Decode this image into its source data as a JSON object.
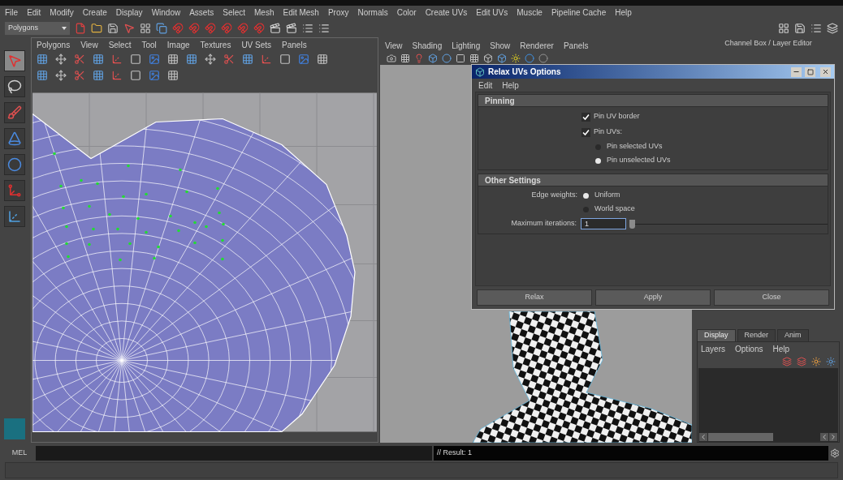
{
  "menu_bar": [
    "File",
    "Edit",
    "Modify",
    "Create",
    "Display",
    "Window",
    "Assets",
    "Select",
    "Mesh",
    "Edit Mesh",
    "Proxy",
    "Normals",
    "Color",
    "Create UVs",
    "Edit UVs",
    "Muscle",
    "Pipeline Cache",
    "Help"
  ],
  "toolbar": {
    "mode_dropdown": "Polygons"
  },
  "toolbox": [
    {
      "kind": "select",
      "selected": true
    },
    {
      "kind": "lasso",
      "selected": false
    },
    {
      "kind": "paint",
      "selected": false
    },
    {
      "kind": "cone",
      "selected": false
    },
    {
      "kind": "sphere",
      "selected": false
    },
    {
      "kind": "scale",
      "selected": false
    },
    {
      "kind": "axis",
      "selected": false
    }
  ],
  "uv_editor": {
    "menu": [
      "Polygons",
      "View",
      "Select",
      "Tool",
      "Image",
      "Textures",
      "UV Sets",
      "Panels"
    ]
  },
  "viewport": {
    "menu": [
      "View",
      "Shading",
      "Lighting",
      "Show",
      "Renderer",
      "Panels"
    ]
  },
  "channel_box": {
    "title": "Channel Box / Layer Editor",
    "tabs": [
      {
        "label": "Display",
        "selected": true
      },
      {
        "label": "Render",
        "selected": false
      },
      {
        "label": "Anim",
        "selected": false
      }
    ],
    "menu": [
      "Layers",
      "Options",
      "Help"
    ]
  },
  "command_line": {
    "language": "MEL",
    "result": "// Result: 1"
  },
  "dialog": {
    "title": "Relax UVs Options",
    "menu": [
      "Edit",
      "Help"
    ],
    "sections": [
      {
        "title": "Pinning",
        "rows": [
          {
            "kind": "checkbox",
            "label": "Pin UV border",
            "checked": true
          },
          {
            "kind": "checkbox",
            "label": "Pin UVs:",
            "checked": true
          },
          {
            "kind": "radio",
            "label": "Pin selected UVs",
            "selected": false
          },
          {
            "kind": "radio",
            "label": "Pin unselected UVs",
            "selected": true
          }
        ]
      },
      {
        "title": "Other Settings",
        "rows": [
          {
            "kind": "radio",
            "caption": "Edge weights:",
            "label": "Uniform",
            "selected": true
          },
          {
            "kind": "radio",
            "label": "World space",
            "selected": false
          },
          {
            "kind": "slider",
            "caption": "Maximum iterations:",
            "value": "1",
            "level": 0
          }
        ]
      }
    ],
    "buttons": [
      "Relax",
      "Apply",
      "Close"
    ]
  }
}
